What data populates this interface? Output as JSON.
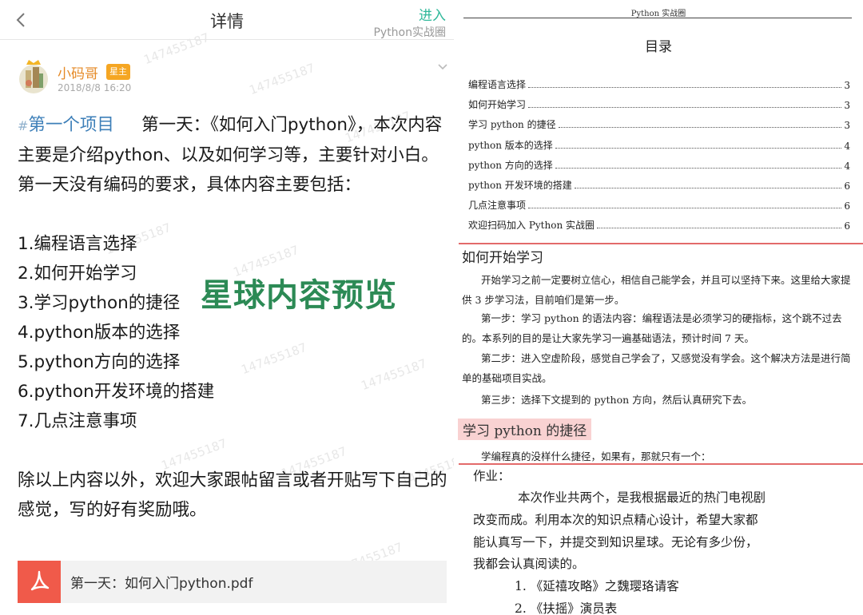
{
  "app": {
    "nav_title": "详情",
    "enter_label": "进入",
    "circle_name": "Python实战圈",
    "author": {
      "name": "小码哥",
      "badge": "星主",
      "time": "2018/8/8 16:20"
    },
    "post": {
      "tag": "第一个项目",
      "intro": "第一天：《如何入门python》，本次内容主要是介绍python、以及如何学习等，主要针对小白。第一天没有编码的要求，具体内容主要包括：",
      "items": [
        "1.编程语言选择",
        "2.如何开始学习",
        "3.学习python的捷径",
        "4.python版本的选择",
        "5.python方向的选择",
        "6.python开发环境的搭建",
        "7.几点注意事项"
      ],
      "closing": "除以上内容以外，欢迎大家跟帖留言或者开贴写下自己的感觉，写的好有奖励哦。"
    },
    "overlay_text": "星球内容预览",
    "attachment": {
      "name": "第一天：如何入门python.pdf"
    },
    "watermark_text": "147455187"
  },
  "doc": {
    "header": "Python 实战圈",
    "toc_title": "目录",
    "toc": [
      {
        "title": "编程语言选择",
        "page": "3"
      },
      {
        "title": "如何开始学习",
        "page": "3"
      },
      {
        "title": "学习 python 的捷径",
        "page": "3"
      },
      {
        "title": "python 版本的选择",
        "page": "4"
      },
      {
        "title": "python 方向的选择",
        "page": "4"
      },
      {
        "title": "python 开发环境的搭建",
        "page": "6"
      },
      {
        "title": "几点注意事项",
        "page": "6"
      },
      {
        "title": "欢迎扫码加入 Python 实战圈",
        "page": "6"
      }
    ],
    "section1": {
      "heading": "如何开始学习",
      "p1": "开始学习之前一定要树立信心，相信自己能学会，并且可以坚持下来。这里给大家提供 3 步学习法，目前咱们是第一步。",
      "p2": "第一步：学习 python 的语法内容：编程语法是必须学习的硬指标，这个跳不过去的。本系列的目的是让大家先学习一遍基础语法，预计时间 7 天。",
      "p3": "第二步：进入空虚阶段，感觉自己学会了，又感觉没有学会。这个解决方法是进行简单的基础项目实战。",
      "p4": "第三步：选择下文提到的 python 方向，然后认真研究下去。"
    },
    "section2": {
      "heading": "学习 python 的捷径",
      "p1": "学编程真的没样什么捷径，如果有，那就只有一个："
    },
    "homework": {
      "label": "作业：",
      "lines": [
        "本次作业共两个，是我根据最近的热门电视剧",
        "改变而成。利用本次的知识点精心设计，希望大家都",
        "能认真写一下，并提交到知识星球。无论有多少份，",
        "我都会认真阅读的。"
      ],
      "items": [
        "1. 《延禧攻略》之魏璎珞请客",
        "2. 《扶摇》演员表"
      ]
    }
  }
}
